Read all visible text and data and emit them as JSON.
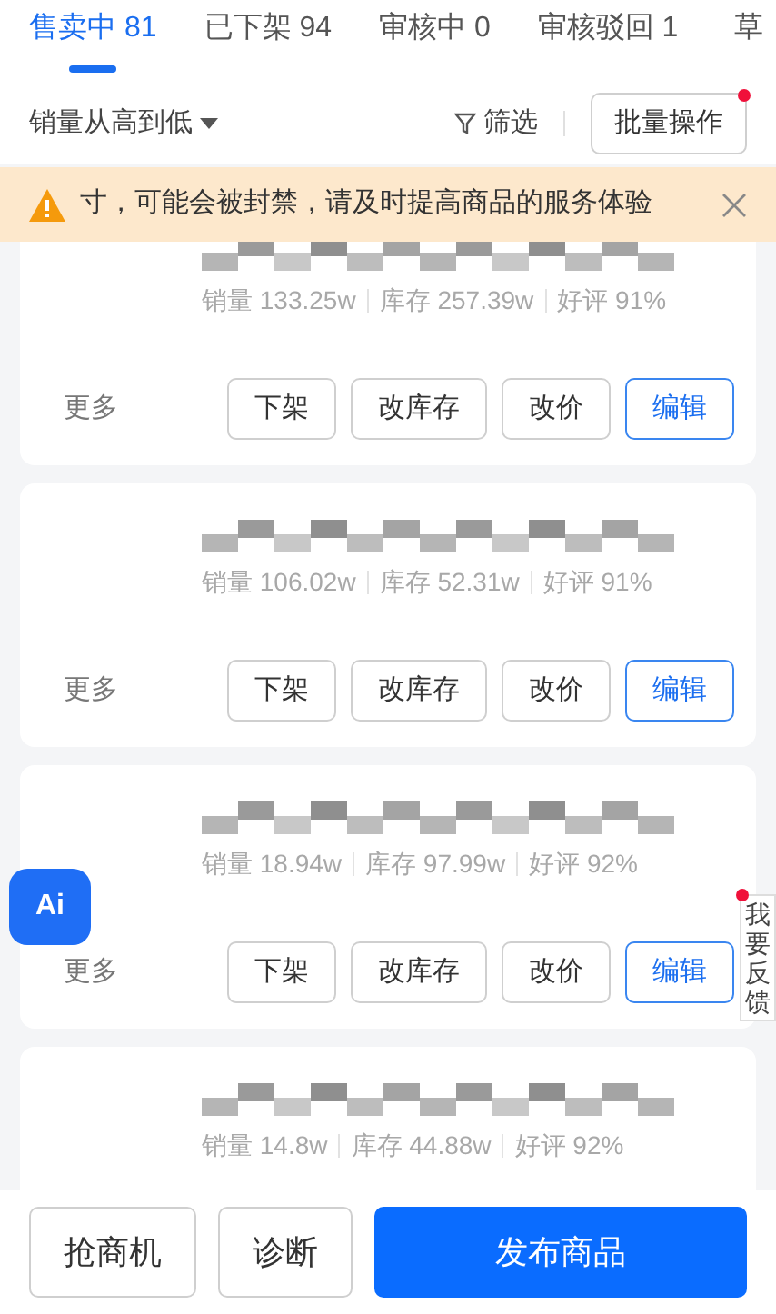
{
  "tabs": [
    {
      "label": "售卖中 81",
      "selected": true
    },
    {
      "label": "已下架 94",
      "selected": false
    },
    {
      "label": "审核中 0",
      "selected": false
    },
    {
      "label": "审核驳回 1",
      "selected": false
    },
    {
      "label": "草",
      "selected": false
    }
  ],
  "toolbar": {
    "sort": "销量从高到低",
    "filter": "筛选",
    "batch": {
      "label": "批量操作",
      "dot": true
    }
  },
  "notice": {
    "text": "寸，可能会被封禁，请及时提高商品的服务体验"
  },
  "products": [
    {
      "sales": "销量 133.25w",
      "stock": "库存 257.39w",
      "rating": "好评 91%",
      "more": "更多",
      "actions": [
        {
          "label": "下架",
          "primary": false
        },
        {
          "label": "改库存",
          "primary": false
        },
        {
          "label": "改价",
          "primary": false
        },
        {
          "label": "编辑",
          "primary": true
        }
      ]
    },
    {
      "sales": "销量 106.02w",
      "stock": "库存 52.31w",
      "rating": "好评 91%",
      "more": "更多",
      "actions": [
        {
          "label": "下架",
          "primary": false
        },
        {
          "label": "改库存",
          "primary": false
        },
        {
          "label": "改价",
          "primary": false
        },
        {
          "label": "编辑",
          "primary": true
        }
      ]
    },
    {
      "sales": "销量 18.94w",
      "stock": "库存 97.99w",
      "rating": "好评 92%",
      "more": "更多",
      "actions": [
        {
          "label": "下架",
          "primary": false
        },
        {
          "label": "改库存",
          "primary": false
        },
        {
          "label": "改价",
          "primary": false
        },
        {
          "label": "编辑",
          "primary": true
        }
      ]
    },
    {
      "sales": "销量 14.8w",
      "stock": "库存 44.88w",
      "rating": "好评 92%"
    }
  ],
  "ai_button": {
    "label": "Ai"
  },
  "feedback": {
    "label": "我要反馈",
    "dot": true
  },
  "footer": [
    {
      "label": "抢商机",
      "primary": false
    },
    {
      "label": "诊断",
      "primary": false
    },
    {
      "label": "发布商品",
      "primary": true
    }
  ]
}
